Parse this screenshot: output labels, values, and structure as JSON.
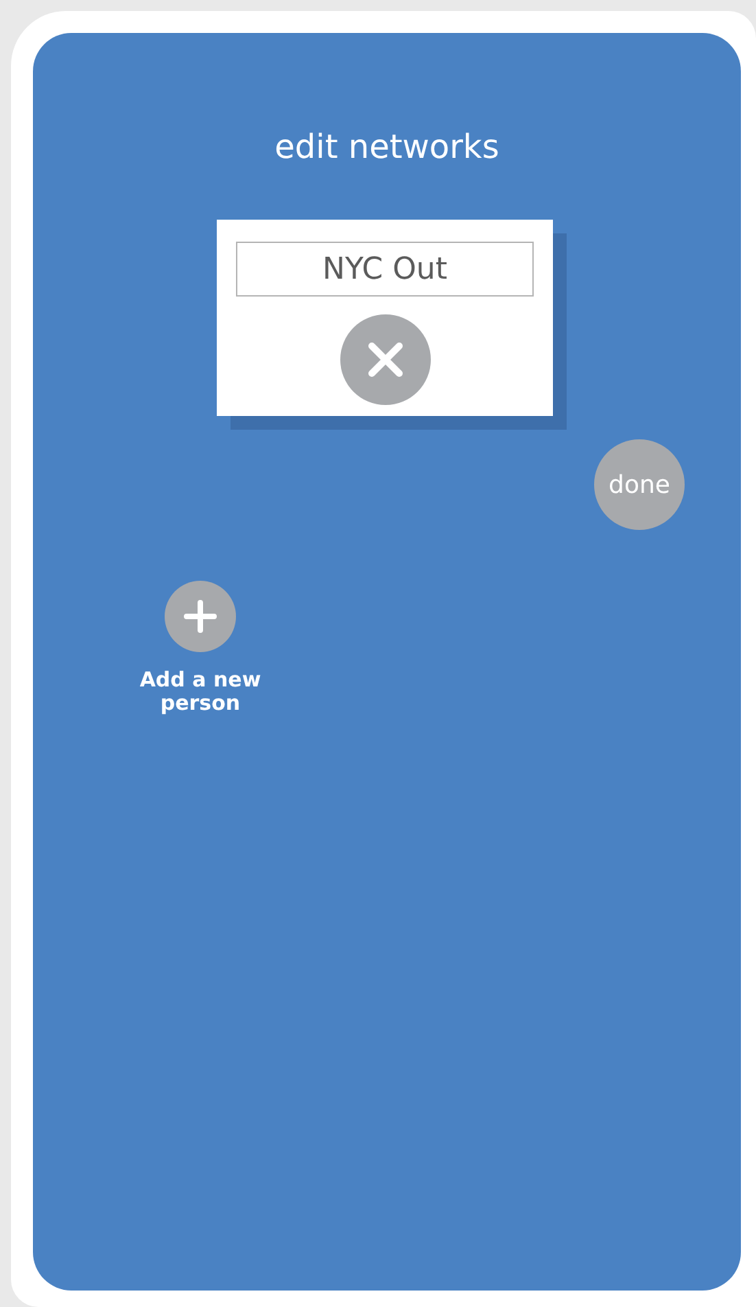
{
  "title": "edit networks",
  "network_card": {
    "name_field": {
      "value": "NYC Out"
    }
  },
  "done_button": {
    "label": "done"
  },
  "add_person": {
    "label": "Add a new person"
  }
}
